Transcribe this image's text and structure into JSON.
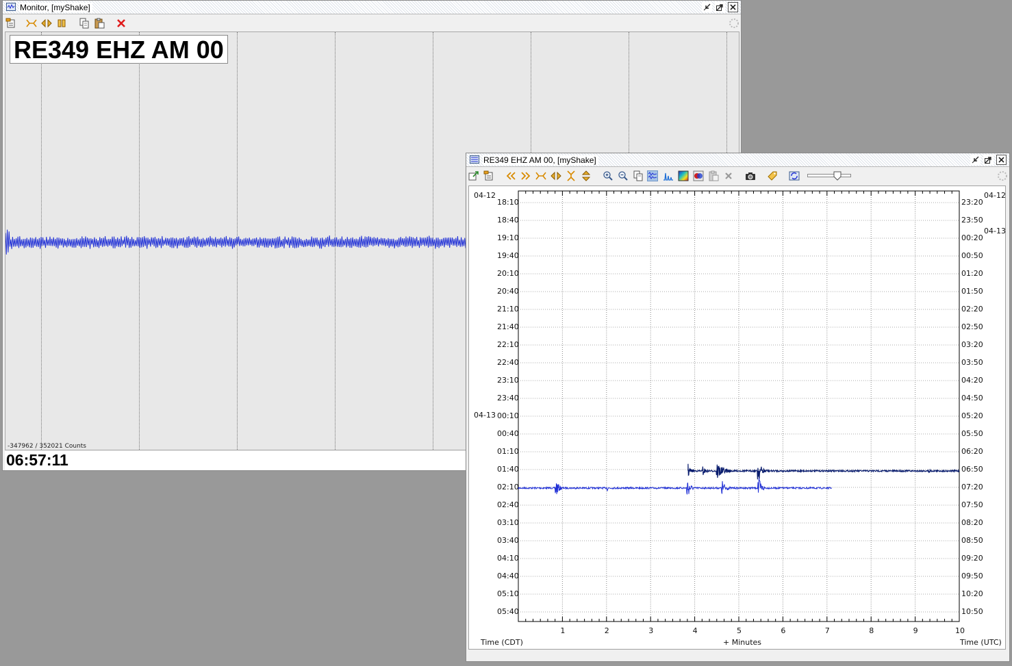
{
  "monitor": {
    "title": "Monitor, [myShake]",
    "station_label": "RE349 EHZ AM 00",
    "counts": "-347962 / 352021 Counts",
    "clock": "06:57:11",
    "toolbar_icons": [
      "channel-list-icon",
      "zoom-fit-icon",
      "expand-horizontal-icon",
      "pause-icon",
      "copy-icon",
      "paste-icon",
      "close-red-icon"
    ]
  },
  "heli": {
    "title": "RE349 EHZ AM 00, [myShake]",
    "date_left_top": "04-12",
    "date_left_mid": "04-13",
    "date_right_top": "04-12",
    "date_right_mid": "04-13",
    "left_times": [
      "18:10",
      "18:40",
      "19:10",
      "19:40",
      "20:10",
      "20:40",
      "21:10",
      "21:40",
      "22:10",
      "22:40",
      "23:10",
      "23:40",
      "00:10",
      "00:40",
      "01:10",
      "01:40",
      "02:10",
      "02:40",
      "03:10",
      "03:40",
      "04:10",
      "04:40",
      "05:10",
      "05:40"
    ],
    "right_times": [
      "23:20",
      "23:50",
      "00:20",
      "00:50",
      "01:20",
      "01:50",
      "02:20",
      "02:50",
      "03:20",
      "03:50",
      "04:20",
      "04:50",
      "05:20",
      "05:50",
      "06:20",
      "06:50",
      "07:20",
      "07:50",
      "08:20",
      "08:50",
      "09:20",
      "09:50",
      "10:20",
      "10:50"
    ],
    "x_ticks": [
      "1",
      "2",
      "3",
      "4",
      "5",
      "6",
      "7",
      "8",
      "9",
      "10"
    ],
    "xlabel": "+ Minutes",
    "left_axis_label": "Time (CDT)",
    "right_axis_label": "Time (UTC)",
    "toolbar_icons": [
      "export-icon",
      "channel-list-icon",
      "scroll-left-icon",
      "scroll-right-icon",
      "zoom-fit-icon",
      "expand-horizontal-icon",
      "expand-vertical-icon",
      "compress-vertical-icon",
      "zoom-in-icon",
      "zoom-out-icon",
      "copy-icon",
      "helicorder-icon",
      "spectrum-icon",
      "spectrogram-icon",
      "filter-icon",
      "paste-icon",
      "close-gray-icon",
      "camera-icon",
      "tag-icon",
      "refresh-icon"
    ],
    "active_tool": "helicorder-icon"
  },
  "colors": {
    "trace_blue": "#1f2fd6",
    "trace_navy": "#0a1d6e",
    "close_red": "#e01b1b",
    "toolbar_orange": "#e8a020"
  }
}
